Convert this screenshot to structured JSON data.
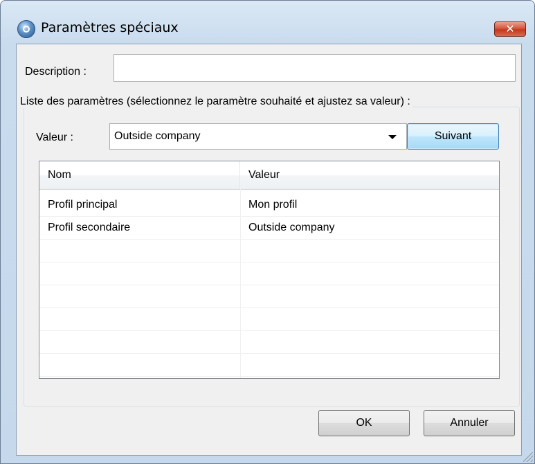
{
  "window": {
    "title": "Paramètres spéciaux",
    "close_glyph": "✕",
    "icon": "app-globe-icon"
  },
  "form": {
    "description_label": "Description :",
    "description_value": "",
    "group_label": "Liste des paramètres (sélectionnez le paramètre souhaité et ajustez sa valeur) :",
    "value_label": "Valeur :",
    "value_selected": "Outside company",
    "next_button": "Suivant"
  },
  "table": {
    "columns": [
      "Nom",
      "Valeur"
    ],
    "rows": [
      {
        "name": "Profil principal",
        "value": "Mon profil"
      },
      {
        "name": "Profil secondaire",
        "value": "Outside company"
      },
      {
        "name": "",
        "value": ""
      },
      {
        "name": "",
        "value": ""
      },
      {
        "name": "",
        "value": ""
      },
      {
        "name": "",
        "value": ""
      },
      {
        "name": "",
        "value": ""
      },
      {
        "name": "",
        "value": ""
      }
    ]
  },
  "footer": {
    "ok_button": "OK",
    "cancel_button": "Annuler"
  },
  "colors": {
    "frame": "#c9dcee",
    "close_button": "#c2381d",
    "default_button_border": "#3c7fb1"
  }
}
